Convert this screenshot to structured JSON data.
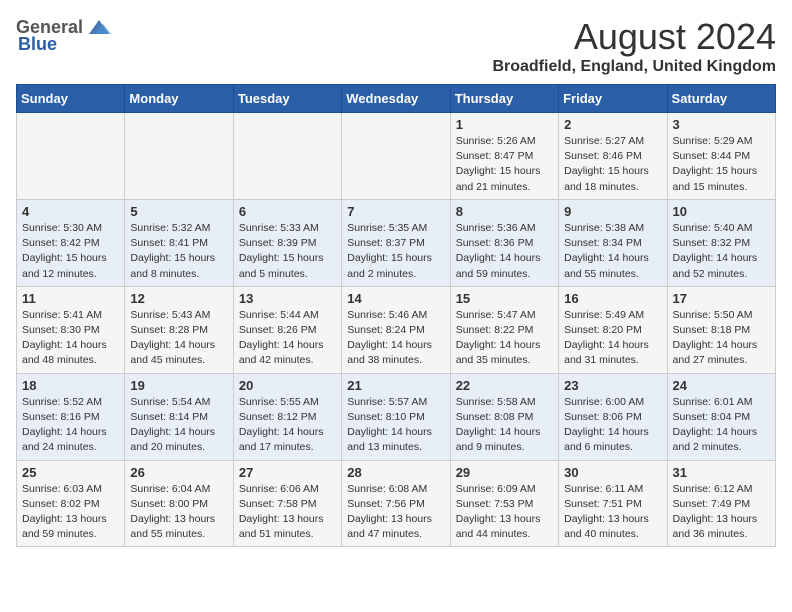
{
  "header": {
    "logo_general": "General",
    "logo_blue": "Blue",
    "month_year": "August 2024",
    "location": "Broadfield, England, United Kingdom"
  },
  "weekdays": [
    "Sunday",
    "Monday",
    "Tuesday",
    "Wednesday",
    "Thursday",
    "Friday",
    "Saturday"
  ],
  "weeks": [
    [
      {
        "day": "",
        "info": ""
      },
      {
        "day": "",
        "info": ""
      },
      {
        "day": "",
        "info": ""
      },
      {
        "day": "",
        "info": ""
      },
      {
        "day": "1",
        "info": "Sunrise: 5:26 AM\nSunset: 8:47 PM\nDaylight: 15 hours\nand 21 minutes."
      },
      {
        "day": "2",
        "info": "Sunrise: 5:27 AM\nSunset: 8:46 PM\nDaylight: 15 hours\nand 18 minutes."
      },
      {
        "day": "3",
        "info": "Sunrise: 5:29 AM\nSunset: 8:44 PM\nDaylight: 15 hours\nand 15 minutes."
      }
    ],
    [
      {
        "day": "4",
        "info": "Sunrise: 5:30 AM\nSunset: 8:42 PM\nDaylight: 15 hours\nand 12 minutes."
      },
      {
        "day": "5",
        "info": "Sunrise: 5:32 AM\nSunset: 8:41 PM\nDaylight: 15 hours\nand 8 minutes."
      },
      {
        "day": "6",
        "info": "Sunrise: 5:33 AM\nSunset: 8:39 PM\nDaylight: 15 hours\nand 5 minutes."
      },
      {
        "day": "7",
        "info": "Sunrise: 5:35 AM\nSunset: 8:37 PM\nDaylight: 15 hours\nand 2 minutes."
      },
      {
        "day": "8",
        "info": "Sunrise: 5:36 AM\nSunset: 8:36 PM\nDaylight: 14 hours\nand 59 minutes."
      },
      {
        "day": "9",
        "info": "Sunrise: 5:38 AM\nSunset: 8:34 PM\nDaylight: 14 hours\nand 55 minutes."
      },
      {
        "day": "10",
        "info": "Sunrise: 5:40 AM\nSunset: 8:32 PM\nDaylight: 14 hours\nand 52 minutes."
      }
    ],
    [
      {
        "day": "11",
        "info": "Sunrise: 5:41 AM\nSunset: 8:30 PM\nDaylight: 14 hours\nand 48 minutes."
      },
      {
        "day": "12",
        "info": "Sunrise: 5:43 AM\nSunset: 8:28 PM\nDaylight: 14 hours\nand 45 minutes."
      },
      {
        "day": "13",
        "info": "Sunrise: 5:44 AM\nSunset: 8:26 PM\nDaylight: 14 hours\nand 42 minutes."
      },
      {
        "day": "14",
        "info": "Sunrise: 5:46 AM\nSunset: 8:24 PM\nDaylight: 14 hours\nand 38 minutes."
      },
      {
        "day": "15",
        "info": "Sunrise: 5:47 AM\nSunset: 8:22 PM\nDaylight: 14 hours\nand 35 minutes."
      },
      {
        "day": "16",
        "info": "Sunrise: 5:49 AM\nSunset: 8:20 PM\nDaylight: 14 hours\nand 31 minutes."
      },
      {
        "day": "17",
        "info": "Sunrise: 5:50 AM\nSunset: 8:18 PM\nDaylight: 14 hours\nand 27 minutes."
      }
    ],
    [
      {
        "day": "18",
        "info": "Sunrise: 5:52 AM\nSunset: 8:16 PM\nDaylight: 14 hours\nand 24 minutes."
      },
      {
        "day": "19",
        "info": "Sunrise: 5:54 AM\nSunset: 8:14 PM\nDaylight: 14 hours\nand 20 minutes."
      },
      {
        "day": "20",
        "info": "Sunrise: 5:55 AM\nSunset: 8:12 PM\nDaylight: 14 hours\nand 17 minutes."
      },
      {
        "day": "21",
        "info": "Sunrise: 5:57 AM\nSunset: 8:10 PM\nDaylight: 14 hours\nand 13 minutes."
      },
      {
        "day": "22",
        "info": "Sunrise: 5:58 AM\nSunset: 8:08 PM\nDaylight: 14 hours\nand 9 minutes."
      },
      {
        "day": "23",
        "info": "Sunrise: 6:00 AM\nSunset: 8:06 PM\nDaylight: 14 hours\nand 6 minutes."
      },
      {
        "day": "24",
        "info": "Sunrise: 6:01 AM\nSunset: 8:04 PM\nDaylight: 14 hours\nand 2 minutes."
      }
    ],
    [
      {
        "day": "25",
        "info": "Sunrise: 6:03 AM\nSunset: 8:02 PM\nDaylight: 13 hours\nand 59 minutes."
      },
      {
        "day": "26",
        "info": "Sunrise: 6:04 AM\nSunset: 8:00 PM\nDaylight: 13 hours\nand 55 minutes."
      },
      {
        "day": "27",
        "info": "Sunrise: 6:06 AM\nSunset: 7:58 PM\nDaylight: 13 hours\nand 51 minutes."
      },
      {
        "day": "28",
        "info": "Sunrise: 6:08 AM\nSunset: 7:56 PM\nDaylight: 13 hours\nand 47 minutes."
      },
      {
        "day": "29",
        "info": "Sunrise: 6:09 AM\nSunset: 7:53 PM\nDaylight: 13 hours\nand 44 minutes."
      },
      {
        "day": "30",
        "info": "Sunrise: 6:11 AM\nSunset: 7:51 PM\nDaylight: 13 hours\nand 40 minutes."
      },
      {
        "day": "31",
        "info": "Sunrise: 6:12 AM\nSunset: 7:49 PM\nDaylight: 13 hours\nand 36 minutes."
      }
    ]
  ]
}
